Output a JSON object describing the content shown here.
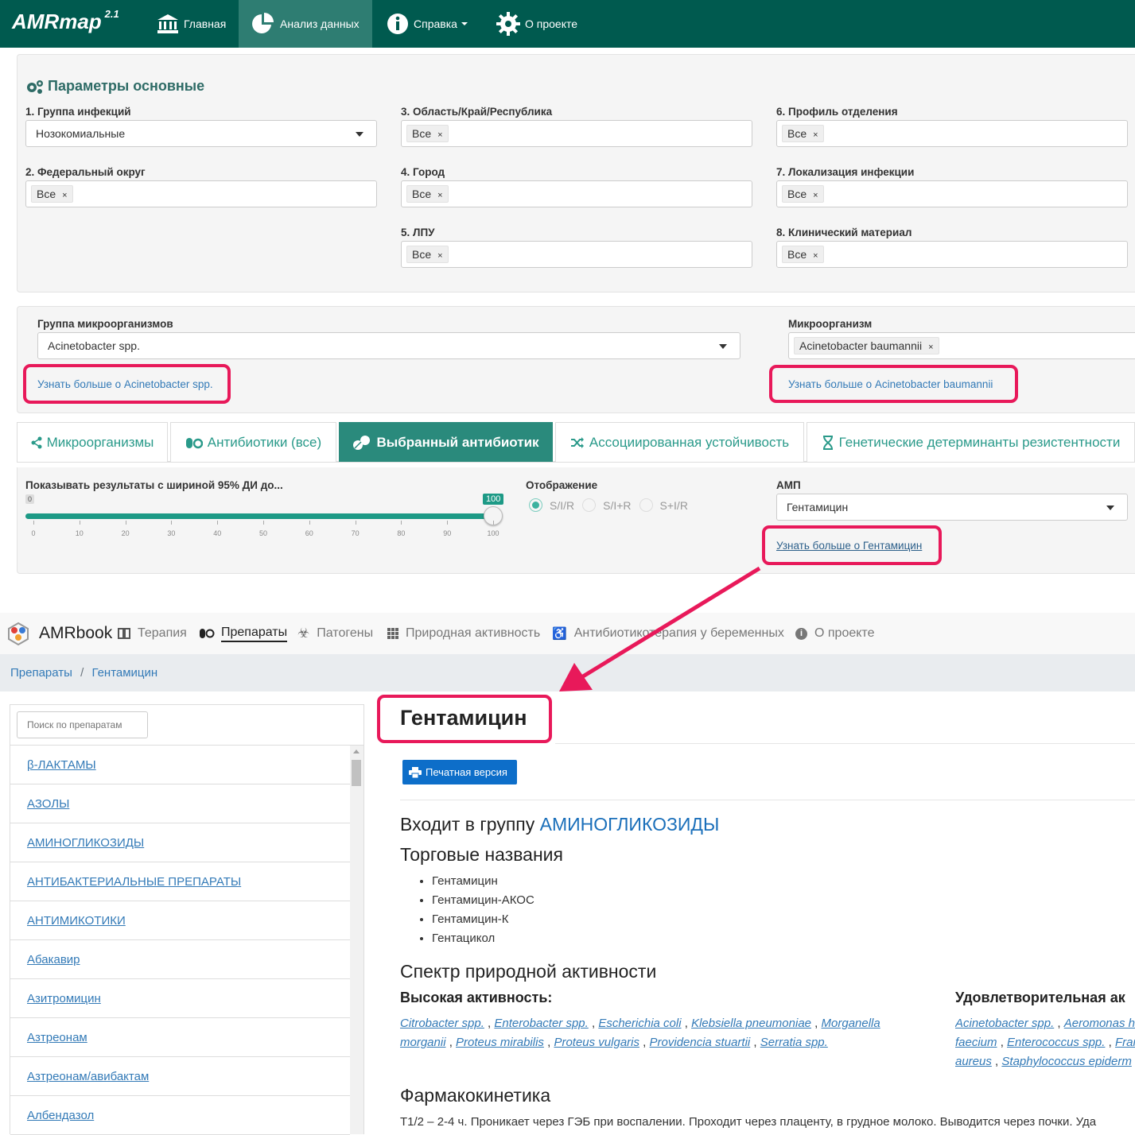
{
  "navbar": {
    "brand": "AMRmap",
    "version": "2.1",
    "items": [
      {
        "label": "Главная"
      },
      {
        "label": "Анализ данных"
      },
      {
        "label": "Справка"
      },
      {
        "label": "О проекте"
      }
    ]
  },
  "params": {
    "title": "Параметры основные",
    "chip_all": "Все",
    "fields": [
      {
        "label": "1. Группа инфекций",
        "value": "Нозокомиальные"
      },
      {
        "label": "2. Федеральный округ",
        "value": "Все"
      },
      {
        "label": "3. Область/Край/Республика",
        "value": "Все"
      },
      {
        "label": "4. Город",
        "value": "Все"
      },
      {
        "label": "5. ЛПУ",
        "value": "Все"
      },
      {
        "label": "6. Профиль отделения",
        "value": "Все"
      },
      {
        "label": "7. Локализация инфекции",
        "value": "Все"
      },
      {
        "label": "8. Клинический материал",
        "value": "Все"
      }
    ]
  },
  "micro": {
    "group_label": "Группа микроорганизмов",
    "group_value": "Acinetobacter spp.",
    "group_link": "Узнать больше о Acinetobacter spp.",
    "org_label": "Микроорганизм",
    "org_value": "Acinetobacter baumannii",
    "org_link": "Узнать больше о Acinetobacter baumannii"
  },
  "tabs": [
    {
      "label": "Микроорганизмы"
    },
    {
      "label": "Антибиотики (все)"
    },
    {
      "label": "Выбранный антибиотик"
    },
    {
      "label": "Ассоциированная устойчивость"
    },
    {
      "label": "Генетические детерминанты резистентности"
    }
  ],
  "controls": {
    "slider_label": "Показывать результаты с шириной 95% ДИ до...",
    "slider_min_badge": "0",
    "slider_value": "100",
    "slider_fraction": 1.0,
    "ticks": [
      "0",
      "10",
      "20",
      "30",
      "40",
      "50",
      "60",
      "70",
      "80",
      "90",
      "100"
    ],
    "display_label": "Отображение",
    "radios": [
      "S/I/R",
      "S/I+R",
      "S+I/R"
    ],
    "amp_label": "АМП",
    "amp_value": "Гентамицин",
    "amp_link": "Узнать больше о Гентамицин"
  },
  "amrbook": {
    "brand": "AMRbook",
    "nav": [
      "Терапия",
      "Препараты",
      "Патогены",
      "Природная активность",
      "Антибиотикотерапия у беременных",
      "О проекте"
    ],
    "breadcrumb": [
      "Препараты",
      "Гентамицин"
    ],
    "breadcrumb_sep": "/",
    "search_placeholder": "Поиск по препаратам",
    "side_items": [
      "β-ЛАКТАМЫ",
      "АЗОЛЫ",
      "АМИНОГЛИКОЗИДЫ",
      "АНТИБАКТЕРИАЛЬНЫЕ ПРЕПАРАТЫ",
      "АНТИМИКОТИКИ",
      "Абакавир",
      "Азитромицин",
      "Азтреонам",
      "Азтреонам/авибактам",
      "Албендазол"
    ],
    "drug_title": "Гентамицин",
    "print_button": "Печатная версия",
    "group_prefix": "Входит в группу",
    "group_name": "АМИНОГЛИКОЗИДЫ",
    "trade_heading": "Торговые названия",
    "trade_names": [
      "Гентамицин",
      "Гентамицин-АКОС",
      "Гентамицин-К",
      "Гентацикол"
    ],
    "spectrum_heading": "Спектр природной активности",
    "high_heading": "Высокая активность:",
    "high_list": [
      "Citrobacter spp.",
      "Enterobacter spp.",
      "Escherichia coli",
      "Klebsiella pneumoniae",
      "Morganella morganii",
      "Proteus mirabilis",
      "Proteus vulgaris",
      "Providencia stuartii",
      "Serratia spp."
    ],
    "sat_heading": "Удовлетворительная ак",
    "sat_line1": [
      "Acinetobacter spp.",
      "Aeromonas h"
    ],
    "sat_line2": [
      "faecium",
      "Enterococcus spp.",
      "Fran"
    ],
    "sat_line3": [
      "aureus",
      "Staphylococcus epiderm"
    ],
    "pk_heading": "Фармакокинетика",
    "pk_text": "T1/2 – 2-4 ч. Проникает через ГЭБ при воспалении. Проходит через плаценту, в грудное молоко. Выводится через почки. Уда"
  },
  "colors": {
    "navbar": "#005a4f",
    "tab_active": "#2a8a7c",
    "highlight": "#e8195a",
    "link": "#337ab7",
    "print_button": "#0d6ec9"
  }
}
